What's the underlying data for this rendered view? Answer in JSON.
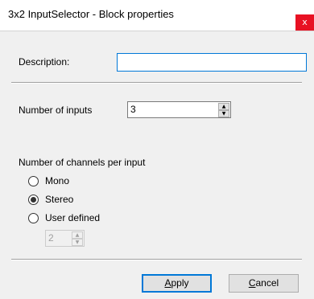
{
  "window": {
    "title": "3x2 InputSelector - Block properties",
    "close_glyph": "x"
  },
  "form": {
    "description_label": "Description:",
    "description_value": "",
    "inputs_label": "Number of inputs",
    "inputs_value": "3",
    "channels_heading": "Number of channels per input",
    "channel_options": [
      {
        "label": "Mono",
        "selected": false
      },
      {
        "label": "Stereo",
        "selected": true
      },
      {
        "label": "User defined",
        "selected": false
      }
    ],
    "user_defined_value": "2"
  },
  "buttons": {
    "apply_accel": "A",
    "apply_rest": "pply",
    "cancel_accel": "C",
    "cancel_rest": "ancel"
  },
  "colors": {
    "close": "#e81123",
    "focus": "#0078d7",
    "client_bg": "#f0f0f0"
  },
  "icons": {
    "close": "close-icon",
    "spin_up": "spin-up-icon",
    "spin_down": "spin-down-icon"
  }
}
